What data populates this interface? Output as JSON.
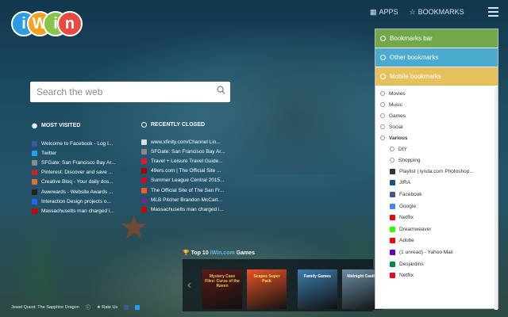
{
  "nav": {
    "apps_label": "APPS",
    "bookmarks_label": "BOOKMARKS"
  },
  "logo": {
    "letters": [
      "i",
      "W",
      "i",
      "n"
    ],
    "colors": [
      "#2d9be0",
      "#f6a21c",
      "#8bc34a",
      "#e84a3f"
    ]
  },
  "search": {
    "placeholder": "Search the web"
  },
  "most_visited": {
    "title": "MOST VISITED",
    "items": [
      {
        "label": "Welcome to Facebook - Log I...",
        "color": "#3b5998"
      },
      {
        "label": "Twitter",
        "color": "#1da1f2"
      },
      {
        "label": "SFGate: San Francisco Bay Ar...",
        "color": "#8a8a8a"
      },
      {
        "label": "Pinterest: Discover and save ...",
        "color": "#cb2027"
      },
      {
        "label": "Creative Bloq - Your daily dos...",
        "color": "#e06f2c"
      },
      {
        "label": "Awwwards - Website Awards ...",
        "color": "#222222"
      },
      {
        "label": "Interaction Design projects o...",
        "color": "#1769ff"
      },
      {
        "label": "Massachusetts man charged i...",
        "color": "#cc0000"
      }
    ]
  },
  "recently_closed": {
    "title": "RECENTLY CLOSED",
    "items": [
      {
        "label": "www.xfinity.com/Channel Lin...",
        "color": "#dddddd"
      },
      {
        "label": "SFGate: San Francisco Bay Ar...",
        "color": "#8a8a8a"
      },
      {
        "label": "Travel + Leisure Travel Guide...",
        "color": "#e31837"
      },
      {
        "label": "49ers.com | The Official Site ...",
        "color": "#aa0000"
      },
      {
        "label": "Summer League Central 2015...",
        "color": "#c9082a"
      },
      {
        "label": "The Official Site of The San Fr...",
        "color": "#fd5a1e"
      },
      {
        "label": "MLB Pitcher Brandon McCart...",
        "color": "#6b2f8a"
      },
      {
        "label": "Massachusetts man charged i...",
        "color": "#cc0000"
      }
    ]
  },
  "games": {
    "title_prefix": "Top 10 ",
    "title_brand": "iWin.com",
    "title_suffix": " Games",
    "tiles": [
      {
        "name": "Mystery Case Files: Curse of the Raven",
        "bg": "#5a1a1a",
        "fg": "#f2c14e"
      },
      {
        "name": "Scapes Super Pack",
        "bg": "#e8532a",
        "fg": "#ffe04a"
      },
      {
        "name": "Family Games",
        "bg": "#3b7fb0",
        "fg": "#ffffff"
      },
      {
        "name": "Midnight Castle",
        "bg": "#6a8fa8",
        "fg": "#ffffff"
      }
    ]
  },
  "footer": {
    "game_name": "Jewel Quest: The Sapphire Dragon",
    "rate": "Rate Us"
  },
  "bookmarks": {
    "bars": [
      {
        "label": "Bookmarks bar",
        "color": "#72a84b"
      },
      {
        "label": "Other bookmarks",
        "color": "#4aaad0"
      },
      {
        "label": "Mobile bookmarks",
        "color": "#e5c15e"
      }
    ],
    "folders": [
      "Movies",
      "Music",
      "Games",
      "Social",
      "Various"
    ],
    "subfolders": [
      "DIY",
      "Shopping"
    ],
    "links": [
      {
        "label": "Playlist | lynda.com Photoshop...",
        "color": "#333333"
      },
      {
        "label": "JIRA",
        "color": "#205081"
      },
      {
        "label": "Facebook",
        "color": "#3b5998"
      },
      {
        "label": "Google",
        "color": "#4285f4"
      },
      {
        "label": "Netflix",
        "color": "#e50914"
      },
      {
        "label": "Dreamweaver",
        "color": "#35fa00"
      },
      {
        "label": "Adobe",
        "color": "#ff0000"
      },
      {
        "label": "(1 unread) - Yahoo Mail",
        "color": "#6001d2"
      },
      {
        "label": "Desjardins",
        "color": "#00874e"
      },
      {
        "label": "Netflix",
        "color": "#e50914"
      }
    ]
  }
}
